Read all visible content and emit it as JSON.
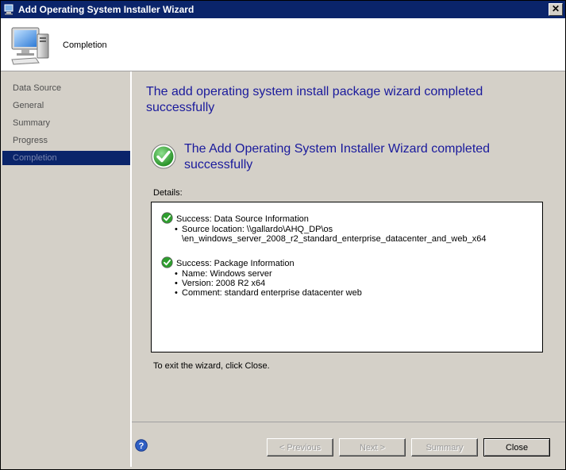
{
  "window": {
    "title": "Add Operating System Installer Wizard",
    "close_glyph": "✕"
  },
  "header": {
    "page_title": "Completion",
    "icon": "computer-icon"
  },
  "nav": {
    "items": [
      {
        "label": "Data Source",
        "active": false
      },
      {
        "label": "General",
        "active": false
      },
      {
        "label": "Summary",
        "active": false
      },
      {
        "label": "Progress",
        "active": false
      },
      {
        "label": "Completion",
        "active": true
      }
    ]
  },
  "content": {
    "main_heading": "The add operating system install package wizard completed successfully",
    "sub_heading": "The Add Operating System Installer Wizard completed successfully",
    "details_label": "Details:",
    "details": [
      {
        "title": "Success: Data Source Information",
        "items": [
          "Source location: \\\\gallardo\\AHQ_DP\\os",
          "\\en_windows_server_2008_r2_standard_enterprise_datacenter_and_web_x64"
        ]
      },
      {
        "title": "Success: Package Information",
        "items": [
          "Name: Windows server",
          "Version: 2008 R2 x64",
          "Comment: standard enterprise datacenter web"
        ]
      }
    ],
    "exit_text": "To exit the wizard, click Close."
  },
  "footer": {
    "previous_label": "< Previous",
    "next_label": "Next >",
    "summary_label": "Summary",
    "close_label": "Close"
  },
  "colors": {
    "title_bar": "#0a246a",
    "heading_text": "#1a1a9c",
    "success_green": "#2e9e2e",
    "window_bg": "#d4d0c8"
  }
}
